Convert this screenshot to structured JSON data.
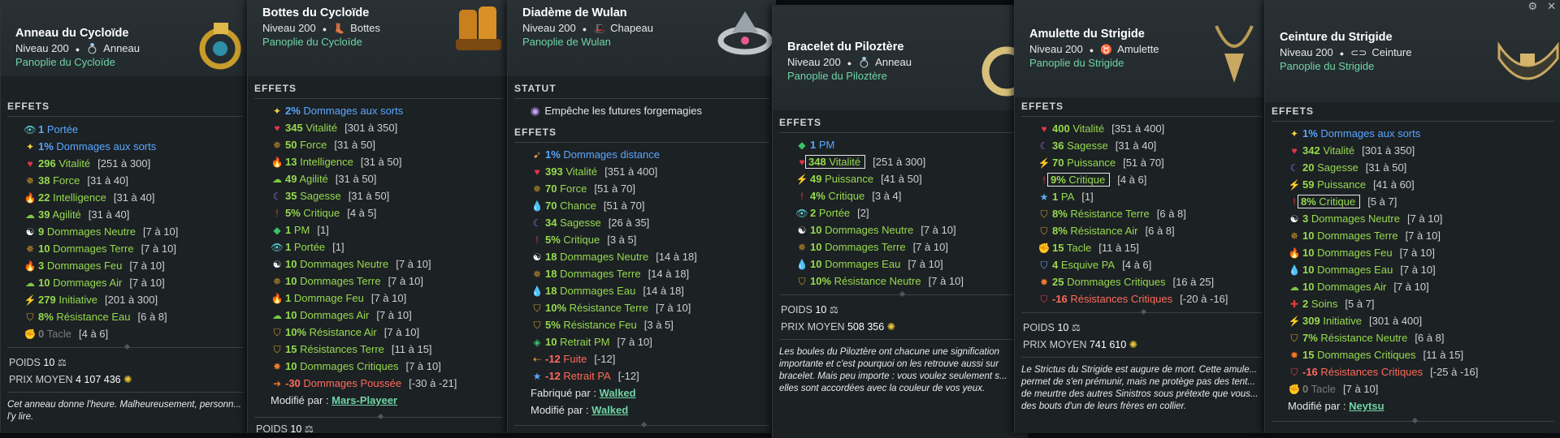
{
  "cards": [
    {
      "title": "Anneau du Cycloïde",
      "level": "Niveau 200",
      "type_icon": "ring-icon",
      "type": "Anneau",
      "set": "Panoplie du Cycloïde",
      "effects_header": "EFFETS",
      "effects": [
        {
          "icon": "eye-icon",
          "ic": "👁",
          "val": "1",
          "name": "Portée",
          "range": "",
          "cls": "blue"
        },
        {
          "icon": "star-icon",
          "ic": "✦",
          "val": "1%",
          "name": "Dommages aux sorts",
          "range": "",
          "cls": "blue"
        },
        {
          "icon": "heart-icon",
          "ic": "♥",
          "val": "296",
          "name": "Vitalité",
          "range": "[251 à 300]",
          "cls": ""
        },
        {
          "icon": "force-icon",
          "ic": "✵",
          "val": "38",
          "name": "Force",
          "range": "[31 à 40]",
          "cls": ""
        },
        {
          "icon": "fire-icon",
          "ic": "🔥",
          "val": "22",
          "name": "Intelligence",
          "range": "[31 à 40]",
          "cls": ""
        },
        {
          "icon": "cloud-icon",
          "ic": "☁",
          "val": "39",
          "name": "Agilité",
          "range": "[31 à 40]",
          "cls": ""
        },
        {
          "icon": "yinyang-icon",
          "ic": "☯",
          "val": "9",
          "name": "Dommages Neutre",
          "range": "[7 à 10]",
          "cls": ""
        },
        {
          "icon": "force-icon",
          "ic": "✵",
          "val": "10",
          "name": "Dommages Terre",
          "range": "[7 à 10]",
          "cls": ""
        },
        {
          "icon": "fire-icon",
          "ic": "🔥",
          "val": "3",
          "name": "Dommages Feu",
          "range": "[7 à 10]",
          "cls": ""
        },
        {
          "icon": "cloud-icon",
          "ic": "☁",
          "val": "10",
          "name": "Dommages Air",
          "range": "[7 à 10]",
          "cls": ""
        },
        {
          "icon": "initiative-icon",
          "ic": "⚡",
          "val": "279",
          "name": "Initiative",
          "range": "[201 à 300]",
          "cls": ""
        },
        {
          "icon": "shield-icon",
          "ic": "⛉",
          "val": "8%",
          "name": "Résistance Eau",
          "range": "[6 à 8]",
          "cls": ""
        },
        {
          "icon": "tackle-icon",
          "ic": "✊",
          "val": "0",
          "name": "Tacle",
          "range": "[4 à 6]",
          "cls": "gray"
        }
      ],
      "poids_label": "POIDS",
      "poids": "10",
      "prix_label": "PRIX MOYEN",
      "prix": "4 107 436",
      "desc": "Cet anneau donne l'heure. Malheureusement, personn... l'y lire."
    },
    {
      "title": "Bottes du Cycloïde",
      "level": "Niveau 200",
      "type_icon": "boots-icon",
      "type": "Bottes",
      "set": "Panoplie du Cycloïde",
      "effects_header": "EFFETS",
      "effects": [
        {
          "icon": "star-icon",
          "ic": "✦",
          "val": "2%",
          "name": "Dommages aux sorts",
          "range": "",
          "cls": "blue"
        },
        {
          "icon": "heart-icon",
          "ic": "♥",
          "val": "345",
          "name": "Vitalité",
          "range": "[301 à 350]",
          "cls": ""
        },
        {
          "icon": "force-icon",
          "ic": "✵",
          "val": "50",
          "name": "Force",
          "range": "[31 à 50]",
          "cls": ""
        },
        {
          "icon": "fire-icon",
          "ic": "🔥",
          "val": "13",
          "name": "Intelligence",
          "range": "[31 à 50]",
          "cls": ""
        },
        {
          "icon": "cloud-icon",
          "ic": "☁",
          "val": "49",
          "name": "Agilité",
          "range": "[31 à 50]",
          "cls": ""
        },
        {
          "icon": "moon-icon",
          "ic": "☾",
          "val": "35",
          "name": "Sagesse",
          "range": "[31 à 50]",
          "cls": ""
        },
        {
          "icon": "crit-icon",
          "ic": "!",
          "val": "5%",
          "name": "Critique",
          "range": "[4 à 5]",
          "cls": ""
        },
        {
          "icon": "pm-icon",
          "ic": "◆",
          "val": "1",
          "name": "PM",
          "range": "[1]",
          "cls": ""
        },
        {
          "icon": "eye-icon",
          "ic": "👁",
          "val": "1",
          "name": "Portée",
          "range": "[1]",
          "cls": ""
        },
        {
          "icon": "yinyang-icon",
          "ic": "☯",
          "val": "10",
          "name": "Dommages Neutre",
          "range": "[7 à 10]",
          "cls": ""
        },
        {
          "icon": "force-icon",
          "ic": "✵",
          "val": "10",
          "name": "Dommages Terre",
          "range": "[7 à 10]",
          "cls": ""
        },
        {
          "icon": "fire-icon",
          "ic": "🔥",
          "val": "1",
          "name": "Dommage Feu",
          "range": "[7 à 10]",
          "cls": ""
        },
        {
          "icon": "cloud-icon",
          "ic": "☁",
          "val": "10",
          "name": "Dommages Air",
          "range": "[7 à 10]",
          "cls": ""
        },
        {
          "icon": "shield-icon",
          "ic": "⛉",
          "val": "10%",
          "name": "Résistance Air",
          "range": "[7 à 10]",
          "cls": ""
        },
        {
          "icon": "shield-icon",
          "ic": "⛉",
          "val": "15",
          "name": "Résistances Terre",
          "range": "[11 à 15]",
          "cls": ""
        },
        {
          "icon": "critdmg-icon",
          "ic": "✸",
          "val": "10",
          "name": "Dommages Critiques",
          "range": "[7 à 10]",
          "cls": ""
        },
        {
          "icon": "push-icon",
          "ic": "➜",
          "val": "-30",
          "name": "Dommages Poussée",
          "range": "[-30 à -21]",
          "cls": "neg"
        }
      ],
      "modif_label": "Modifié par :",
      "modif_user": "Mars-Playeer",
      "poids_label": "POIDS",
      "poids": "10"
    },
    {
      "title": "Diadème de Wulan",
      "level": "Niveau 200",
      "type_icon": "hat-icon",
      "type": "Chapeau",
      "set": "Panoplie de Wulan",
      "status_header": "STATUT",
      "status": "Empêche les futures forgemagies",
      "effects_header": "EFFETS",
      "effects": [
        {
          "icon": "distance-icon",
          "ic": "➹",
          "val": "1%",
          "name": "Dommages distance",
          "range": "",
          "cls": "blue"
        },
        {
          "icon": "heart-icon",
          "ic": "♥",
          "val": "393",
          "name": "Vitalité",
          "range": "[351 à 400]",
          "cls": ""
        },
        {
          "icon": "force-icon",
          "ic": "✵",
          "val": "70",
          "name": "Force",
          "range": "[51 à 70]",
          "cls": ""
        },
        {
          "icon": "water-icon",
          "ic": "💧",
          "val": "70",
          "name": "Chance",
          "range": "[51 à 70]",
          "cls": ""
        },
        {
          "icon": "moon-icon",
          "ic": "☾",
          "val": "34",
          "name": "Sagesse",
          "range": "[26 à 35]",
          "cls": ""
        },
        {
          "icon": "crit-icon",
          "ic": "!",
          "val": "5%",
          "name": "Critique",
          "range": "[3 à 5]",
          "cls": ""
        },
        {
          "icon": "yinyang-icon",
          "ic": "☯",
          "val": "18",
          "name": "Dommages Neutre",
          "range": "[14 à 18]",
          "cls": ""
        },
        {
          "icon": "force-icon",
          "ic": "✵",
          "val": "18",
          "name": "Dommages Terre",
          "range": "[14 à 18]",
          "cls": ""
        },
        {
          "icon": "water-icon",
          "ic": "💧",
          "val": "18",
          "name": "Dommages Eau",
          "range": "[14 à 18]",
          "cls": ""
        },
        {
          "icon": "shield-icon",
          "ic": "⛉",
          "val": "10%",
          "name": "Résistance Terre",
          "range": "[7 à 10]",
          "cls": ""
        },
        {
          "icon": "shield-icon",
          "ic": "⛉",
          "val": "5%",
          "name": "Résistance Feu",
          "range": "[3 à 5]",
          "cls": ""
        },
        {
          "icon": "retraitpm-icon",
          "ic": "◈",
          "val": "10",
          "name": "Retrait PM",
          "range": "[7 à 10]",
          "cls": ""
        },
        {
          "icon": "flee-icon",
          "ic": "⇠",
          "val": "-12",
          "name": "Fuite",
          "range": "[-12]",
          "cls": "neg"
        },
        {
          "icon": "retraitpa-icon",
          "ic": "★",
          "val": "-12",
          "name": "Retrait PA",
          "range": "[-12]",
          "cls": "neg"
        }
      ],
      "fab_label": "Fabriqué par :",
      "fab_user": "Walked",
      "modif_label": "Modifié par :",
      "modif_user": "Walked"
    },
    {
      "title": "Bracelet du Piloztère",
      "level": "Niveau 200",
      "type_icon": "ring-icon",
      "type": "Anneau",
      "set": "Panoplie du Piloztère",
      "effects_header": "EFFETS",
      "effects": [
        {
          "icon": "pm-icon",
          "ic": "◆",
          "val": "1",
          "name": "PM",
          "range": "",
          "cls": "blue"
        },
        {
          "icon": "heart-icon",
          "ic": "♥",
          "val": "348",
          "name": "Vitalité",
          "range": "[251 à 300]",
          "cls": "",
          "boxed": true
        },
        {
          "icon": "power-icon",
          "ic": "⚡",
          "val": "49",
          "name": "Puissance",
          "range": "[41 à 50]",
          "cls": ""
        },
        {
          "icon": "crit-icon",
          "ic": "!",
          "val": "4%",
          "name": "Critique",
          "range": "[3 à 4]",
          "cls": ""
        },
        {
          "icon": "eye-icon",
          "ic": "👁",
          "val": "2",
          "name": "Portée",
          "range": "[2]",
          "cls": ""
        },
        {
          "icon": "yinyang-icon",
          "ic": "☯",
          "val": "10",
          "name": "Dommages Neutre",
          "range": "[7 à 10]",
          "cls": ""
        },
        {
          "icon": "force-icon",
          "ic": "✵",
          "val": "10",
          "name": "Dommages Terre",
          "range": "[7 à 10]",
          "cls": ""
        },
        {
          "icon": "water-icon",
          "ic": "💧",
          "val": "10",
          "name": "Dommages Eau",
          "range": "[7 à 10]",
          "cls": ""
        },
        {
          "icon": "shield-icon",
          "ic": "⛉",
          "val": "10%",
          "name": "Résistance Neutre",
          "range": "[7 à 10]",
          "cls": ""
        }
      ],
      "poids_label": "POIDS",
      "poids": "10",
      "prix_label": "PRIX MOYEN",
      "prix": "508 356",
      "desc": "Les boules du Piloztère ont chacune une signification importante et c'est pourquoi on les retrouve aussi sur bracelet. Mais peu importe : vous voulez seulement s... elles sont accordées avec la couleur de vos yeux."
    },
    {
      "title": "Amulette du Strigide",
      "level": "Niveau 200",
      "type_icon": "amulet-icon",
      "type": "Amulette",
      "set": "Panoplie du Strigide",
      "effects_header": "EFFETS",
      "effects": [
        {
          "icon": "heart-icon",
          "ic": "♥",
          "val": "400",
          "name": "Vitalité",
          "range": "[351 à 400]",
          "cls": ""
        },
        {
          "icon": "moon-icon",
          "ic": "☾",
          "val": "36",
          "name": "Sagesse",
          "range": "[31 à 40]",
          "cls": ""
        },
        {
          "icon": "power-icon",
          "ic": "⚡",
          "val": "70",
          "name": "Puissance",
          "range": "[51 à 70]",
          "cls": ""
        },
        {
          "icon": "crit-icon",
          "ic": "!",
          "val": "9%",
          "name": "Critique",
          "range": "[4 à 6]",
          "cls": "",
          "boxed": true
        },
        {
          "icon": "pa-icon",
          "ic": "★",
          "val": "1",
          "name": "PA",
          "range": "[1]",
          "cls": ""
        },
        {
          "icon": "shield-icon",
          "ic": "⛉",
          "val": "8%",
          "name": "Résistance Terre",
          "range": "[6 à 8]",
          "cls": ""
        },
        {
          "icon": "shield-icon",
          "ic": "⛉",
          "val": "8%",
          "name": "Résistance Air",
          "range": "[6 à 8]",
          "cls": ""
        },
        {
          "icon": "tackle-icon",
          "ic": "✊",
          "val": "15",
          "name": "Tacle",
          "range": "[11 à 15]",
          "cls": ""
        },
        {
          "icon": "dodge-icon",
          "ic": "⛉",
          "val": "4",
          "name": "Esquive PA",
          "range": "[4 à 6]",
          "cls": ""
        },
        {
          "icon": "critdmg-icon",
          "ic": "✸",
          "val": "25",
          "name": "Dommages Critiques",
          "range": "[16 à 25]",
          "cls": ""
        },
        {
          "icon": "critres-icon",
          "ic": "⛉",
          "val": "-16",
          "name": "Résistances Critiques",
          "range": "[-20 à -16]",
          "cls": "neg"
        }
      ],
      "poids_label": "POIDS",
      "poids": "10",
      "prix_label": "PRIX MOYEN",
      "prix": "741 610",
      "desc": "Le Strictus du Strigide est augure de mort. Cette amule... permet de s'en prémunir, mais ne protège pas des tent... de meurtre des autres Sinistros sous prétexte que vous... des bouts d'un de leurs frères en collier."
    },
    {
      "title": "Ceinture du Strigide",
      "level": "Niveau 200",
      "type_icon": "belt-icon",
      "type": "Ceinture",
      "set": "Panoplie du Strigide",
      "effects_header": "EFFETS",
      "effects": [
        {
          "icon": "star-icon",
          "ic": "✦",
          "val": "1%",
          "name": "Dommages aux sorts",
          "range": "",
          "cls": "blue"
        },
        {
          "icon": "heart-icon",
          "ic": "♥",
          "val": "342",
          "name": "Vitalité",
          "range": "[301 à 350]",
          "cls": ""
        },
        {
          "icon": "moon-icon",
          "ic": "☾",
          "val": "20",
          "name": "Sagesse",
          "range": "[31 à 50]",
          "cls": ""
        },
        {
          "icon": "power-icon",
          "ic": "⚡",
          "val": "59",
          "name": "Puissance",
          "range": "[41 à 60]",
          "cls": ""
        },
        {
          "icon": "crit-icon",
          "ic": "!",
          "val": "8%",
          "name": "Critique",
          "range": "[5 à 7]",
          "cls": "",
          "boxed": true
        },
        {
          "icon": "yinyang-icon",
          "ic": "☯",
          "val": "3",
          "name": "Dommages Neutre",
          "range": "[7 à 10]",
          "cls": ""
        },
        {
          "icon": "force-icon",
          "ic": "✵",
          "val": "10",
          "name": "Dommages Terre",
          "range": "[7 à 10]",
          "cls": ""
        },
        {
          "icon": "fire-icon",
          "ic": "🔥",
          "val": "10",
          "name": "Dommages Feu",
          "range": "[7 à 10]",
          "cls": ""
        },
        {
          "icon": "water-icon",
          "ic": "💧",
          "val": "10",
          "name": "Dommages Eau",
          "range": "[7 à 10]",
          "cls": ""
        },
        {
          "icon": "cloud-icon",
          "ic": "☁",
          "val": "10",
          "name": "Dommages Air",
          "range": "[7 à 10]",
          "cls": ""
        },
        {
          "icon": "heal-icon",
          "ic": "✚",
          "val": "2",
          "name": "Soins",
          "range": "[5 à 7]",
          "cls": ""
        },
        {
          "icon": "initiative-icon",
          "ic": "⚡",
          "val": "309",
          "name": "Initiative",
          "range": "[301 à 400]",
          "cls": ""
        },
        {
          "icon": "shield-icon",
          "ic": "⛉",
          "val": "7%",
          "name": "Résistance Neutre",
          "range": "[6 à 8]",
          "cls": ""
        },
        {
          "icon": "critdmg-icon",
          "ic": "✸",
          "val": "15",
          "name": "Dommages Critiques",
          "range": "[11 à 15]",
          "cls": ""
        },
        {
          "icon": "critres-icon",
          "ic": "⛉",
          "val": "-16",
          "name": "Résistances Critiques",
          "range": "[-25 à -16]",
          "cls": "neg"
        },
        {
          "icon": "tackle-icon",
          "ic": "✊",
          "val": "0",
          "name": "Tacle",
          "range": "[7 à 10]",
          "cls": "gray"
        }
      ],
      "modif_label": "Modifié par :",
      "modif_user": "Neytsu"
    }
  ],
  "colors": {
    "bonus": "#96d94e",
    "malus": "#ff6a5a",
    "exotic": "#5aa6ff",
    "set": "#6fd4a5"
  }
}
